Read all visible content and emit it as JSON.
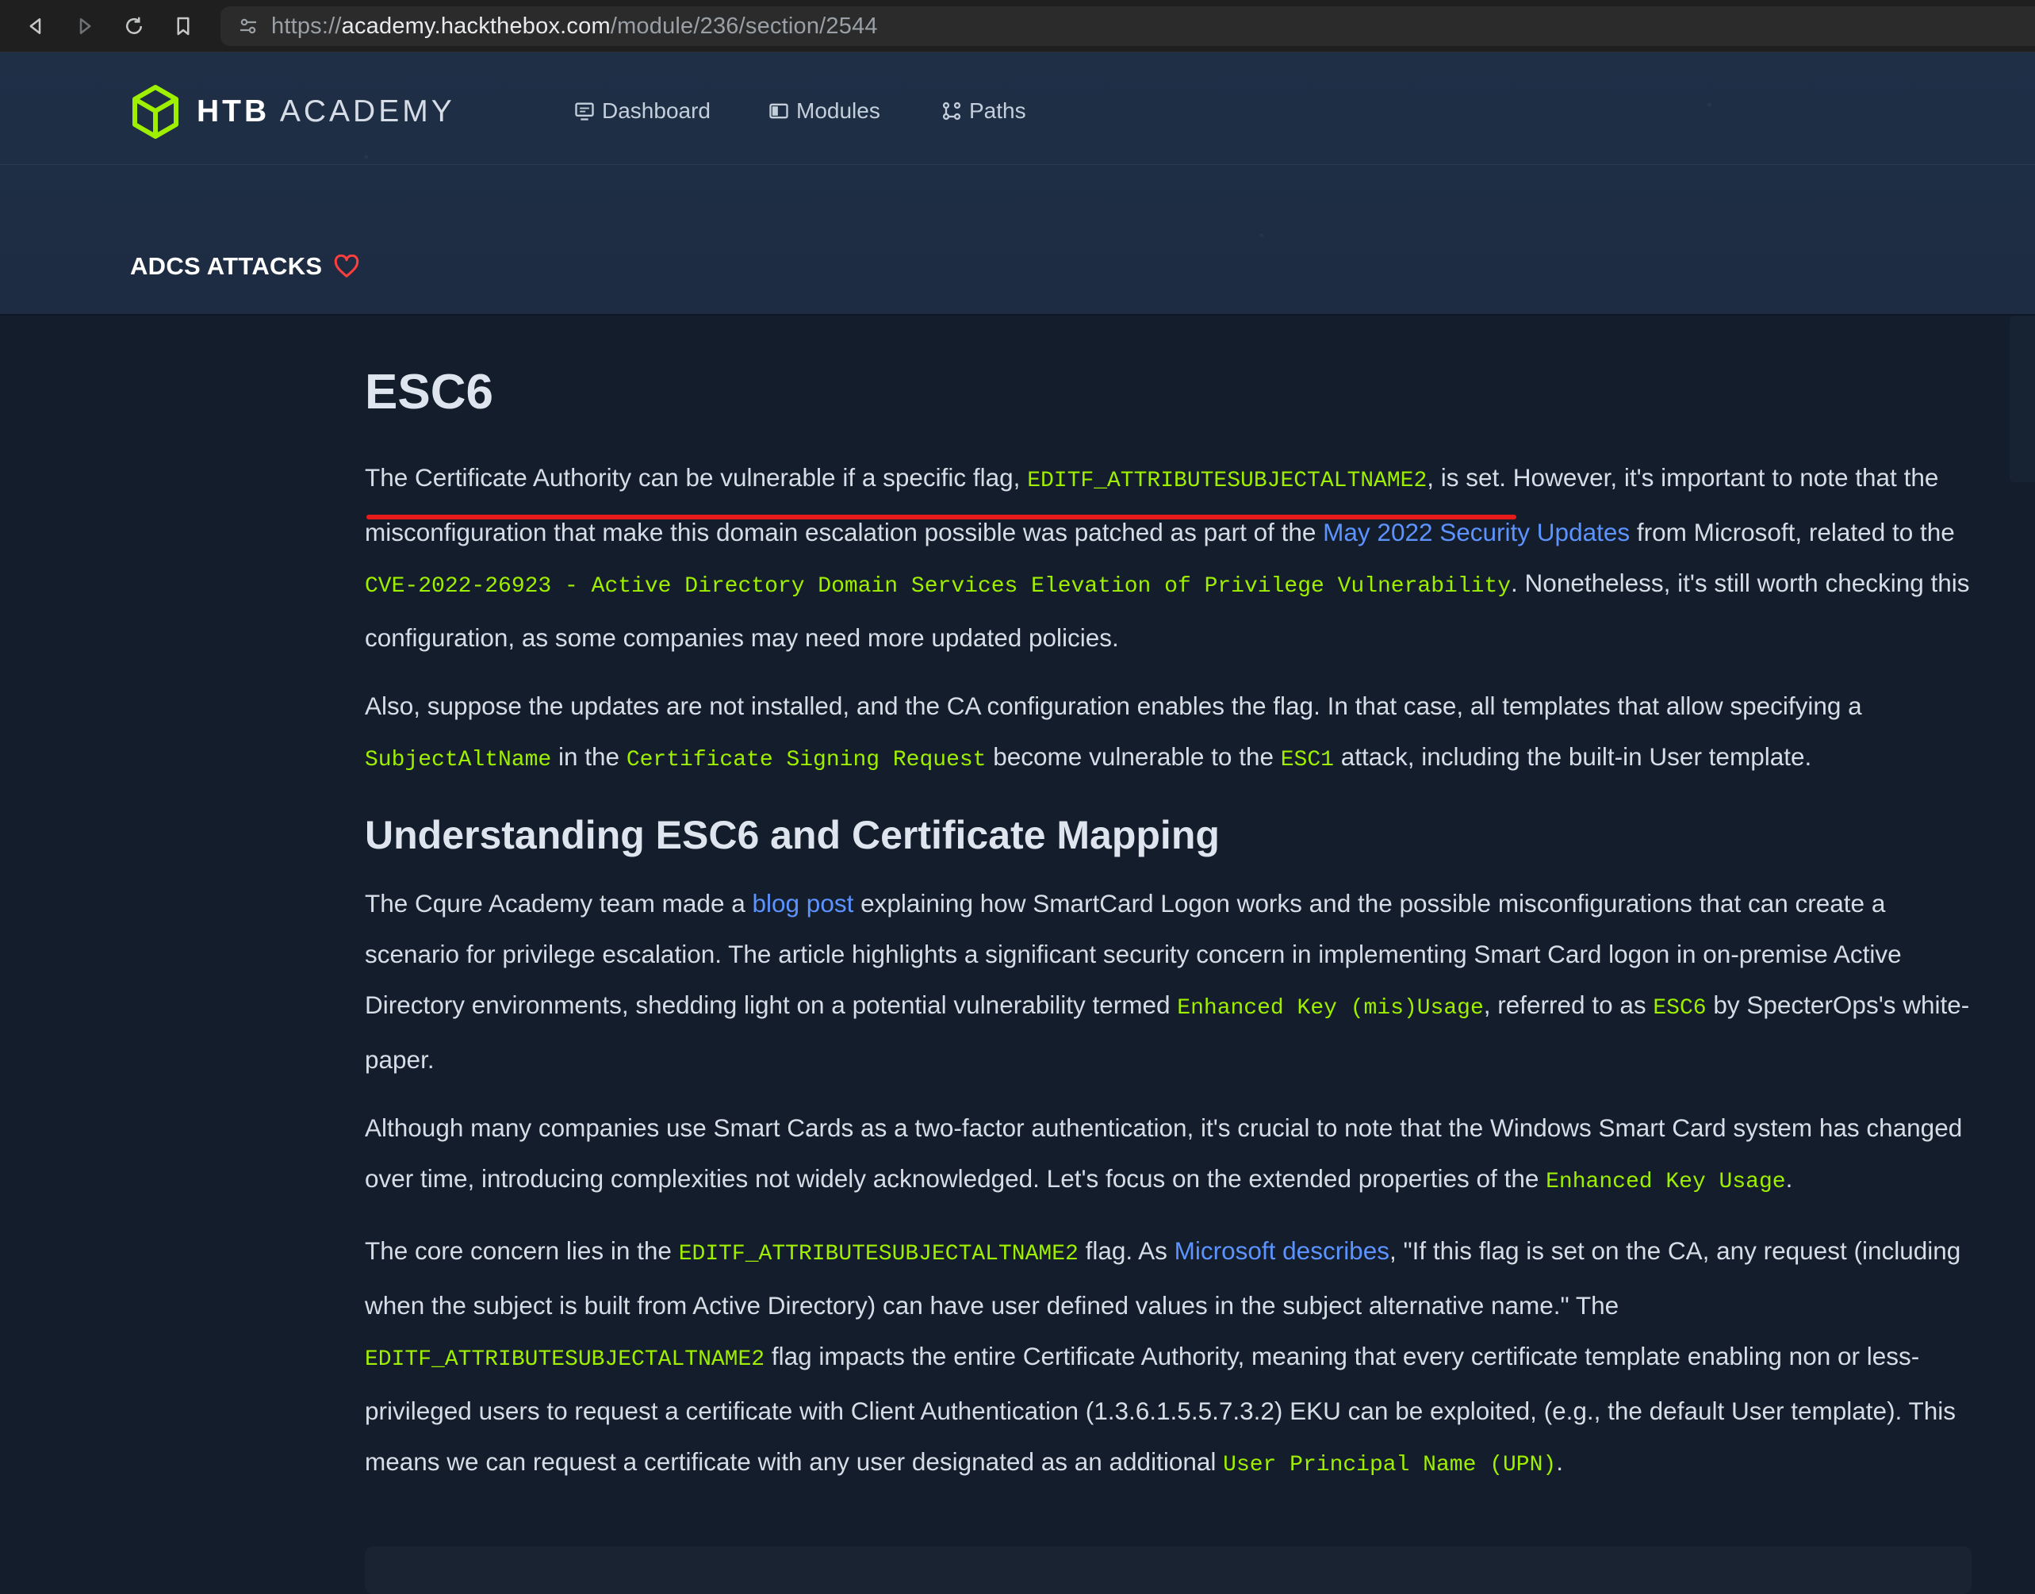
{
  "browser": {
    "url_prefix": "https://",
    "url_host": "academy.hackthebox.com",
    "url_path": "/module/236/section/2544"
  },
  "header": {
    "logo_bold": "HTB",
    "logo_light": "ACADEMY",
    "nav": {
      "dashboard": "Dashboard",
      "modules": "Modules",
      "paths": "Paths"
    },
    "module_title": "ADCS ATTACKS"
  },
  "article": {
    "title": "ESC6",
    "p1": {
      "t1": "The Certificate Authority can be vulnerable if a specific flag, ",
      "c1": "EDITF_ATTRIBUTESUBJECTALTNAME2",
      "t2": ", is set. However, it's important to note that the misconfiguration that make this domain escalation possible was patched as part of the ",
      "link1": "May 2022 Security Updates",
      "t3": " from Microsoft, related to the ",
      "c2": "CVE-2022-26923 - Active Directory Domain Services Elevation of Privilege Vulnerability",
      "t4": ". Nonetheless, it's still worth checking this configuration, as some companies may need more updated policies."
    },
    "p2": {
      "t1": "Also, suppose the updates are not installed, and the CA configuration enables the flag. In that case, all templates that allow specifying a ",
      "c1": "SubjectAltName",
      "t2": " in the ",
      "c2": "Certificate Signing Request",
      "t3": " become vulnerable to the ",
      "c3": "ESC1",
      "t4": " attack, including the built-in User template."
    },
    "h2": "Understanding ESC6 and Certificate Mapping",
    "p3": {
      "t1": "The Cqure Academy team made a ",
      "link1": "blog post",
      "t2": " explaining how SmartCard Logon works and the possible misconfigurations that can create a scenario for privilege escalation. The article highlights a significant security concern in implementing Smart Card logon in on-premise Active Directory environments, shedding light on a potential vulnerability termed ",
      "c1": "Enhanced Key (mis)Usage",
      "t3": ", referred to as ",
      "c2": "ESC6",
      "t4": " by SpecterOps's white-paper."
    },
    "p4": {
      "t1": "Although many companies use Smart Cards as a two-factor authentication, it's crucial to note that the Windows Smart Card system has changed over time, introducing complexities not widely acknowledged. Let's focus on the extended properties of the ",
      "c1": "Enhanced Key Usage",
      "t2": "."
    },
    "p5": {
      "t1": "The core concern lies in the ",
      "c1": "EDITF_ATTRIBUTESUBJECTALTNAME2",
      "t2": " flag. As ",
      "link1": "Microsoft describes",
      "t3": ", \"If this flag is set on the CA, any request (including when the subject is built from Active Directory) can have user defined values in the subject alternative name.\" The ",
      "c2": "EDITF_ATTRIBUTESUBJECTALTNAME2",
      "t4": " flag impacts the entire Certificate Authority, meaning that every certificate template enabling non or less-privileged users to request a certificate with Client Authentication (1.3.6.1.5.5.7.3.2) EKU can be exploited, (e.g., the default User template). This means we can request a certificate with any user designated as an additional ",
      "c3": "User Principal Name (UPN)",
      "t5": "."
    }
  },
  "colors": {
    "accent_green": "#9fef00",
    "link_blue": "#5c93ff",
    "annotation_red": "#e81b1b",
    "heart_red": "#ff3e3e"
  },
  "icons": [
    "back-icon",
    "forward-icon",
    "reload-icon",
    "bookmark-icon",
    "site-settings-icon",
    "htb-cube-logo",
    "dashboard-icon",
    "modules-icon",
    "paths-icon",
    "heart-icon"
  ]
}
